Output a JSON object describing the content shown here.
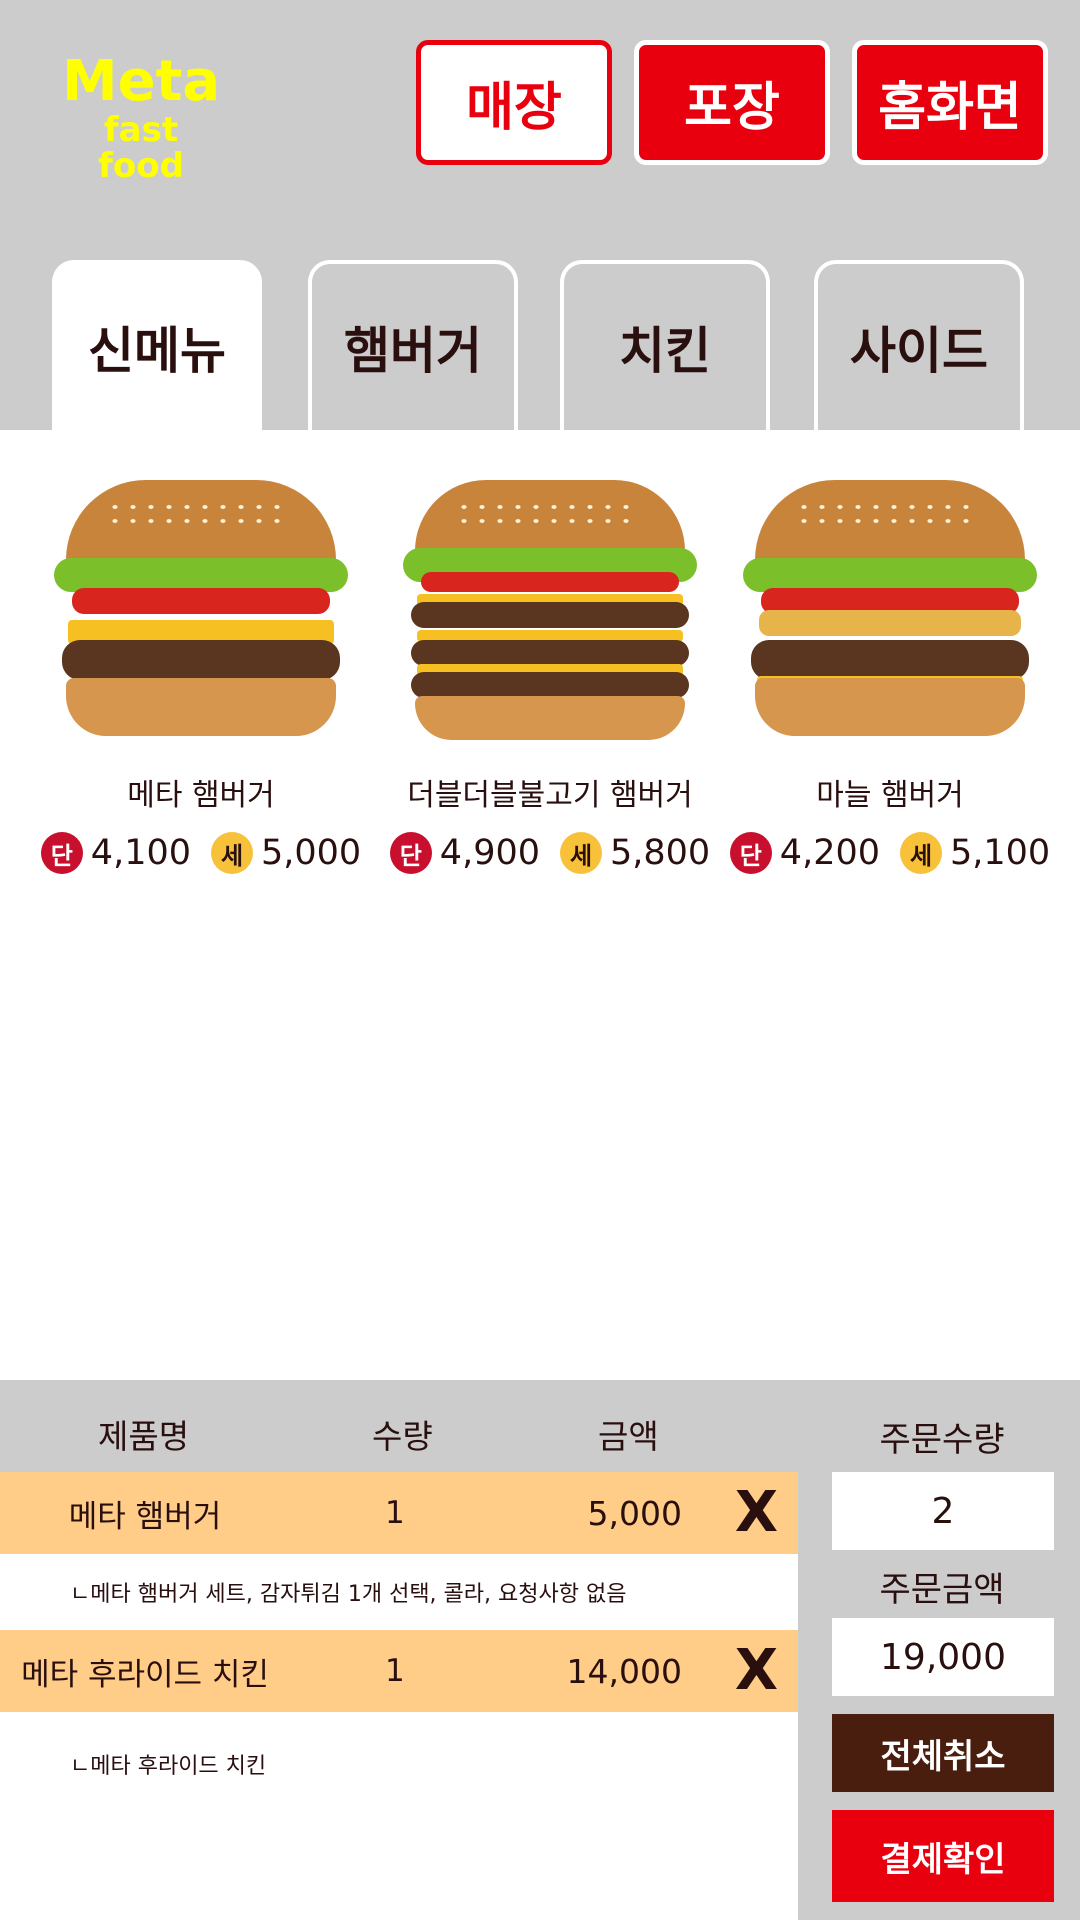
{
  "logo": {
    "main": "Meta",
    "sub": "fast food"
  },
  "top_buttons": {
    "dine_in": "매장",
    "takeout": "포장",
    "home": "홈화면"
  },
  "tabs": [
    {
      "label": "신메뉴",
      "active": true
    },
    {
      "label": "햄버거",
      "active": false
    },
    {
      "label": "치킨",
      "active": false
    },
    {
      "label": "사이드",
      "active": false
    }
  ],
  "products": [
    {
      "name": "메타 햄버거",
      "single_badge": "단",
      "single_price": "4,100",
      "set_badge": "세",
      "set_price": "5,000"
    },
    {
      "name": "더블더블불고기 햄버거",
      "single_badge": "단",
      "single_price": "4,900",
      "set_badge": "세",
      "set_price": "5,800"
    },
    {
      "name": "마늘 햄버거",
      "single_badge": "단",
      "single_price": "4,200",
      "set_badge": "세",
      "set_price": "5,100"
    }
  ],
  "order": {
    "columns": {
      "name": "제품명",
      "qty": "수량",
      "amount": "금액"
    },
    "items": [
      {
        "name": "메타 햄버거",
        "qty": "1",
        "amount": "5,000",
        "delete": "X",
        "detail": "ㄴ메타 햄버거 세트, 감자튀김 1개 선택, 콜라, 요청사항 없음"
      },
      {
        "name": "메타 후라이드 치킨",
        "qty": "1",
        "amount": "14,000",
        "delete": "X",
        "detail": "ㄴ메타 후라이드 치킨"
      }
    ],
    "total_qty_label": "주문수량",
    "total_qty": "2",
    "total_amount_label": "주문금액",
    "total_amount": "19,000",
    "cancel_all": "전체취소",
    "pay_confirm": "결제확인"
  }
}
